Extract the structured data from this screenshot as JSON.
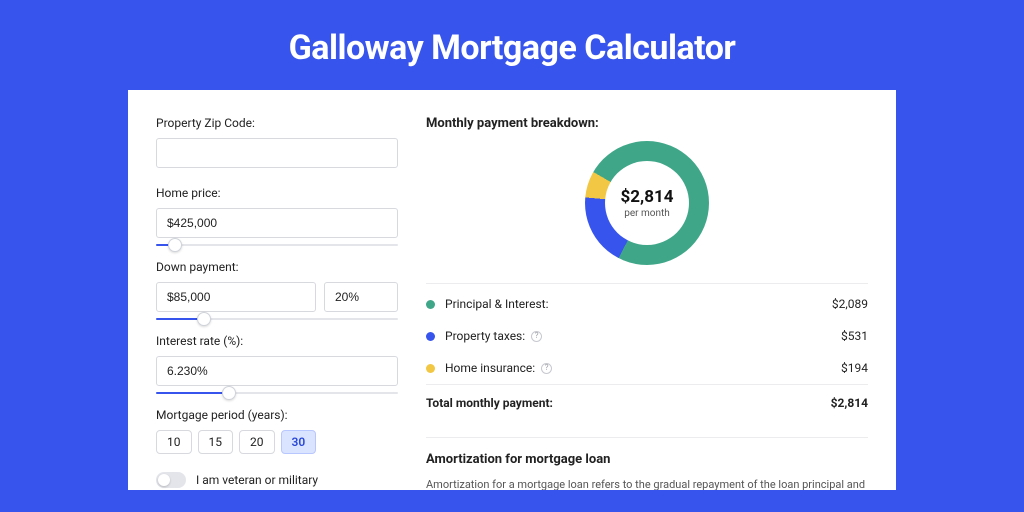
{
  "header": {
    "title": "Galloway Mortgage Calculator"
  },
  "form": {
    "zip": {
      "label": "Property Zip Code:",
      "value": ""
    },
    "price": {
      "label": "Home price:",
      "value": "$425,000",
      "slider_pct": 8
    },
    "down": {
      "label": "Down payment:",
      "value": "$85,000",
      "pct": "20%",
      "slider_pct": 20
    },
    "rate": {
      "label": "Interest rate (%):",
      "value": "6.230%",
      "slider_pct": 30
    },
    "period": {
      "label": "Mortgage period (years):",
      "options": [
        "10",
        "15",
        "20",
        "30"
      ],
      "selected": "30"
    },
    "veteran_label": "I am veteran or military",
    "veteran_on": false
  },
  "breakdown": {
    "title": "Monthly payment breakdown:",
    "center_amount": "$2,814",
    "center_sub": "per month",
    "items": [
      {
        "key": "principal",
        "label": "Principal & Interest:",
        "value": "$2,089",
        "color": "#3fa788",
        "info": false
      },
      {
        "key": "taxes",
        "label": "Property taxes:",
        "value": "$531",
        "color": "#3754ed",
        "info": true
      },
      {
        "key": "insurance",
        "label": "Home insurance:",
        "value": "$194",
        "color": "#f2c744",
        "info": true
      }
    ],
    "total_label": "Total monthly payment:",
    "total_value": "$2,814"
  },
  "amortization": {
    "title": "Amortization for mortgage loan",
    "text": "Amortization for a mortgage loan refers to the gradual repayment of the loan principal and interest over a specified"
  },
  "chart_data": {
    "type": "pie",
    "title": "Monthly payment breakdown",
    "series": [
      {
        "name": "Principal & Interest",
        "value": 2089,
        "color": "#3fa788"
      },
      {
        "name": "Property taxes",
        "value": 531,
        "color": "#3754ed"
      },
      {
        "name": "Home insurance",
        "value": 194,
        "color": "#f2c744"
      }
    ],
    "total": 2814,
    "center_label": "$2,814 per month"
  }
}
